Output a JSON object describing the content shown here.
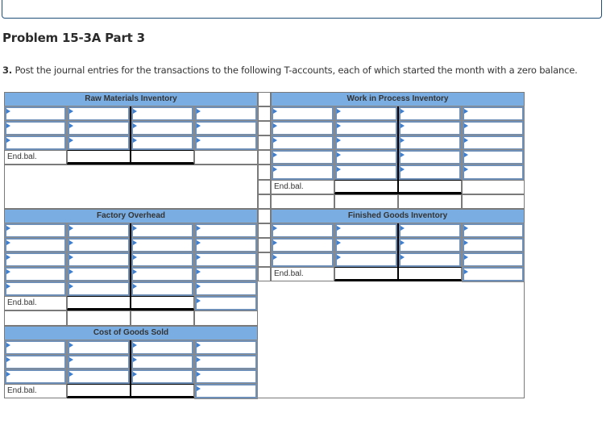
{
  "problem_title": "Problem 15-3A Part 3",
  "instruction": {
    "number": "3.",
    "text": " Post the journal entries for the transactions to the following T-accounts, each of which started the month with a zero balance."
  },
  "accounts": {
    "raw_materials": {
      "title": "Raw Materials Inventory",
      "end_label": "End.bal."
    },
    "work_in_process": {
      "title": "Work in Process Inventory",
      "end_label": "End.bal."
    },
    "factory_overhead": {
      "title": "Factory Overhead",
      "end_label": "End.bal."
    },
    "finished_goods": {
      "title": "Finished Goods Inventory",
      "end_label": "End.bal."
    },
    "cost_of_goods_sold": {
      "title": "Cost of Goods Sold",
      "end_label": "End.bal."
    }
  },
  "colors": {
    "header_bg": "#7aaee3",
    "input_border": "#6d8fb8",
    "input_marker": "#3f7fcf",
    "frame": "#1f4e79"
  }
}
